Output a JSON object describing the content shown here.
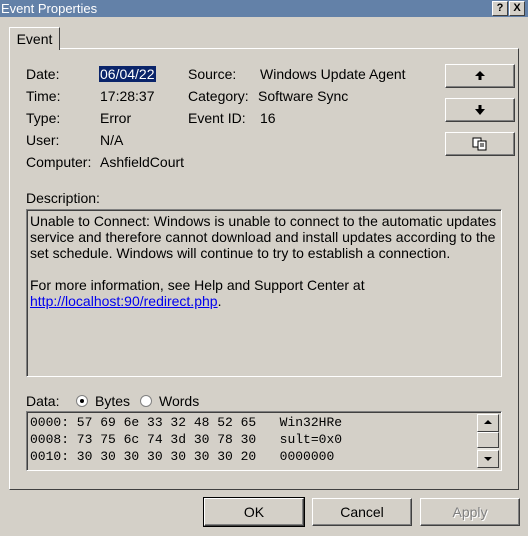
{
  "window": {
    "title": "Event Properties",
    "help_glyph": "?",
    "close_glyph": "X"
  },
  "tabs": [
    {
      "label": "Event"
    }
  ],
  "fields": {
    "date_label": "Date:",
    "date_value": "06/04/22",
    "time_label": "Time:",
    "time_value": "17:28:37",
    "type_label": "Type:",
    "type_value": "Error",
    "user_label": "User:",
    "user_value": "N/A",
    "computer_label": "Computer:",
    "computer_value": "AshfieldCourt",
    "source_label": "Source:",
    "source_value": "Windows Update Agent",
    "category_label": "Category:",
    "category_value": "Software Sync",
    "eventid_label": "Event ID:",
    "eventid_value": "16"
  },
  "nav_buttons": {
    "up_icon": "arrow-up-icon",
    "down_icon": "arrow-down-icon",
    "copy_icon": "copy-icon"
  },
  "description": {
    "label": "Description:",
    "text": "Unable to Connect: Windows is unable to connect to the automatic updates service and therefore cannot download and install updates according to the set schedule. Windows will continue to try to establish a connection.",
    "more_info": "For more information, see Help and Support Center at",
    "link": "http://localhost:90/redirect.php",
    "link_suffix": "."
  },
  "data_section": {
    "label": "Data:",
    "options": [
      {
        "label": "Bytes",
        "selected": true
      },
      {
        "label": "Words",
        "selected": false
      }
    ],
    "lines": [
      "0000: 57 69 6e 33 32 48 52 65   Win32HRe",
      "0008: 73 75 6c 74 3d 30 78 30   sult=0x0",
      "0010: 30 30 30 30 30 30 30 20   0000000"
    ]
  },
  "buttons": {
    "ok": "OK",
    "cancel": "Cancel",
    "apply": "Apply"
  },
  "colors": {
    "titlebar": "#6381a8",
    "face": "#d4d0c8",
    "selection": "#0a246a",
    "link": "#0000ee"
  }
}
